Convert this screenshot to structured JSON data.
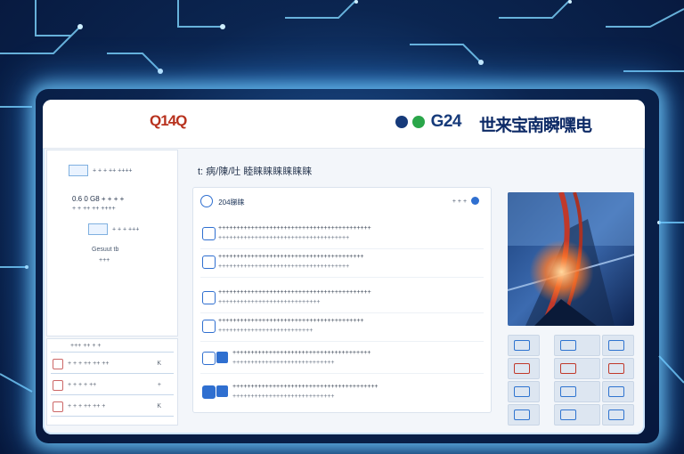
{
  "header": {
    "logo_left": "Q14Q",
    "logo_left_sub": "",
    "brand_code": "G24",
    "brand_title": "世来宝南瞬嘿电"
  },
  "left_card": {
    "line1": "+ + + ++ ++++",
    "line2": "0.6 0 G8 + + + +",
    "line3": "+ + ++ ++ ++++",
    "line4": "+ + + +++",
    "line5": "Gesuut  tb",
    "line6": "+++"
  },
  "left_list": {
    "header": "+++ ++ + +",
    "rows": [
      {
        "text": "+ + + ++ ++ ++",
        "mark": "K"
      },
      {
        "text": "+ + + + ++",
        "mark": "+"
      },
      {
        "text": "+ + + ++ ++ +",
        "mark": "K"
      }
    ]
  },
  "main": {
    "section_title": "t: 病/陳/吐 睦睐睐睐睐睐睐",
    "panel_title": "204睇睐",
    "panel_user": "+ + +",
    "items": [
      {
        "l1": "++++++++++++++++++++++++++++++++++++++++++",
        "l2": "++++++++++++++++++++++++++++++++++++"
      },
      {
        "l1": "++++++++++++++++++++++++++++++++++++++++",
        "l2": "++++++++++++++++++++++++++++++++++++"
      },
      {
        "l1": "++++++++++++++++++++++++++++++++++++++++++",
        "l2": "++++++++++++++++++++++++++++"
      },
      {
        "l1": "++++++++++++++++++++++++++++++++++++++++",
        "l2": "++++++++++++++++++++++++++"
      },
      {
        "l1": "++++++++++++++++++++++++++++++++++++++",
        "l2": "++++++++++++++++++++++++++++"
      },
      {
        "l1": "++++++++++++++++++++++++++++++++++++++++",
        "l2": "++++++++++++++++++++++++++++"
      }
    ]
  },
  "colors": {
    "accent": "#2f6fd0",
    "brand": "#163a7a",
    "logo": "#b8321e",
    "glow": "#78d2ff"
  }
}
